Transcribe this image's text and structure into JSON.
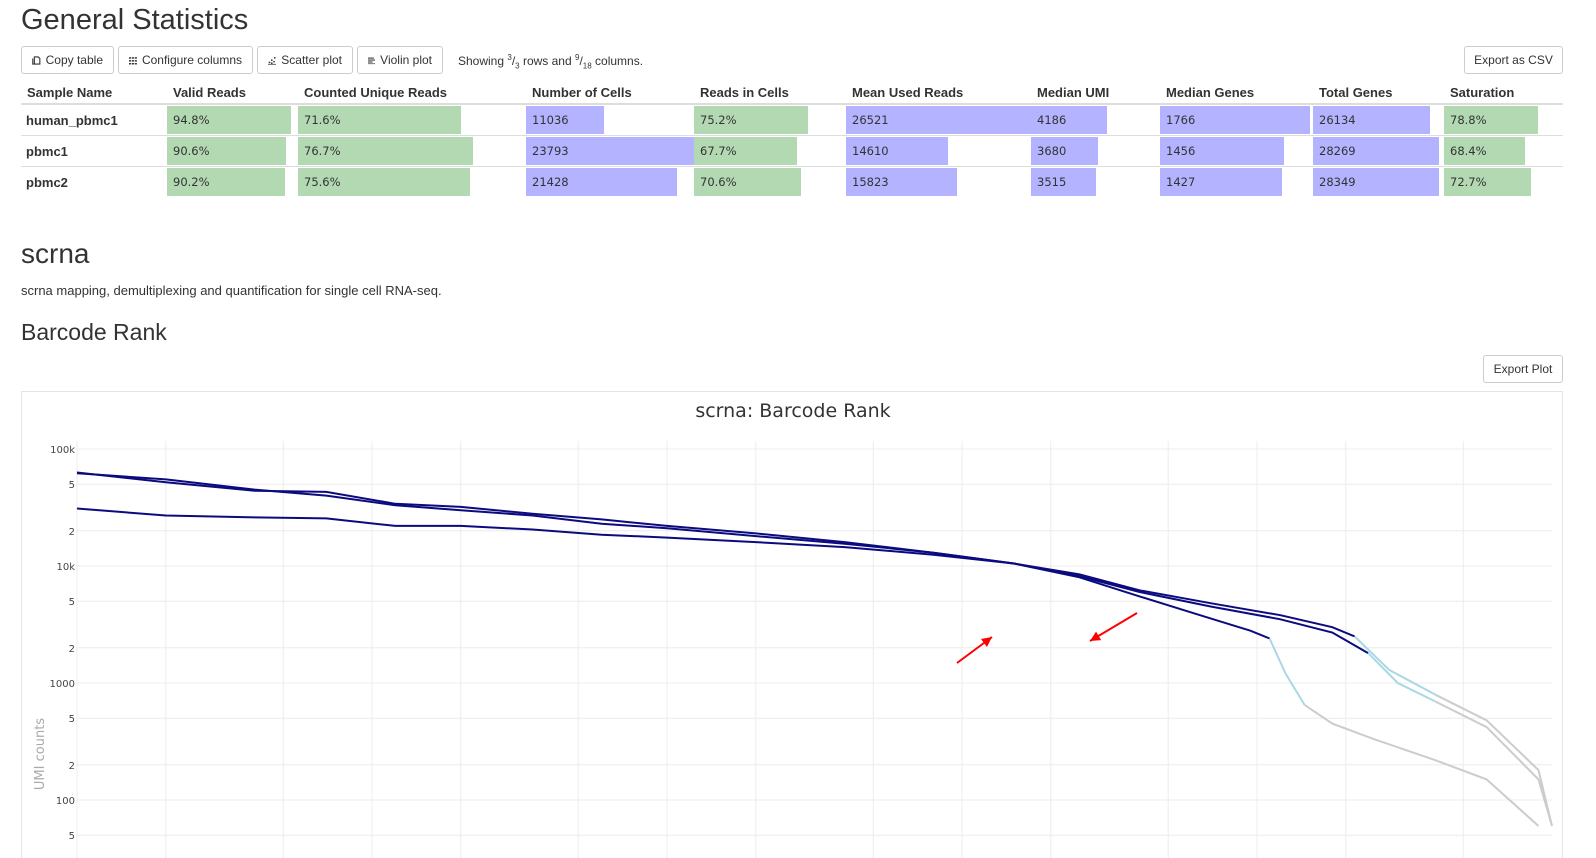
{
  "general_stats": {
    "title": "General Statistics",
    "buttons": {
      "copy": "Copy table",
      "configure": "Configure columns",
      "scatter": "Scatter plot",
      "violin": "Violin plot",
      "export_csv": "Export as CSV"
    },
    "showing": {
      "prefix": "Showing ",
      "rows_num": "3",
      "rows_den": "3",
      "mid": " rows and ",
      "cols_num": "9",
      "cols_den": "18",
      "suffix": " columns."
    },
    "columns": [
      "Sample Name",
      "Valid Reads",
      "Counted Unique Reads",
      "Number of Cells",
      "Reads in Cells",
      "Mean Used Reads",
      "Median UMI",
      "Median Genes",
      "Total Genes",
      "Saturation"
    ],
    "rows": [
      {
        "name": "human_pbmc1",
        "cells": [
          "94.8%",
          "71.6%",
          "11036",
          "75.2%",
          "26521",
          "4186",
          "1766",
          "26134",
          "78.8%"
        ],
        "fills": [
          0.948,
          0.716,
          0.464,
          0.752,
          0.998,
          0.59,
          0.98,
          0.89,
          0.788
        ]
      },
      {
        "name": "pbmc1",
        "cells": [
          "90.6%",
          "76.7%",
          "23793",
          "67.7%",
          "14610",
          "3680",
          "1456",
          "28269",
          "68.4%"
        ],
        "fills": [
          0.906,
          0.767,
          1.0,
          0.677,
          0.55,
          0.52,
          0.81,
          0.96,
          0.684
        ]
      },
      {
        "name": "pbmc2",
        "cells": [
          "90.2%",
          "75.6%",
          "21428",
          "70.6%",
          "15823",
          "3515",
          "1427",
          "28349",
          "72.7%"
        ],
        "fills": [
          0.902,
          0.756,
          0.9,
          0.706,
          0.6,
          0.5,
          0.8,
          0.965,
          0.727
        ]
      }
    ],
    "bar_colors": {
      "percent": "#b3d9b3",
      "count": "#b3b3ff"
    }
  },
  "section": {
    "title": "scrna",
    "description": "scrna mapping, demultiplexing and quantification for single cell RNA-seq."
  },
  "barcode_rank": {
    "heading": "Barcode Rank",
    "export_button": "Export Plot"
  },
  "chart_data": {
    "type": "line",
    "title": "scrna: Barcode Rank",
    "ylabel": "UMI counts",
    "xlabel": "",
    "yscale": "log",
    "ylim": [
      40,
      100000
    ],
    "xscale": "log",
    "xlim": [
      1,
      100000
    ],
    "y_ticks": [
      "100k",
      "5",
      "2",
      "10k",
      "5",
      "2",
      "1000",
      "5",
      "2",
      "100",
      "5"
    ],
    "grid": true,
    "colors": {
      "cells": "#0b0b7f",
      "background": "#a8d8e6",
      "empty": "#cccccc",
      "arrows": "#ff0000"
    },
    "series": [
      {
        "x": [
          1,
          2,
          4,
          7,
          12,
          20,
          35,
          60,
          100,
          200,
          400,
          800,
          1500,
          2500,
          4000,
          6000,
          8000,
          9500,
          11036
        ],
        "y": [
          62000,
          55000,
          45000,
          40000,
          33000,
          30000,
          27000,
          23000,
          21000,
          18000,
          15500,
          13000,
          10500,
          8000,
          5500,
          4000,
          3200,
          2800,
          2400
        ],
        "bg_x": [
          11036,
          12500,
          14500,
          18000,
          25000,
          40000,
          60000,
          90000
        ],
        "bg_y": [
          2400,
          1200,
          650,
          450,
          330,
          220,
          150,
          60
        ]
      },
      {
        "x": [
          1,
          2,
          4,
          7,
          12,
          20,
          35,
          60,
          100,
          200,
          400,
          800,
          1500,
          2500,
          4000,
          7000,
          12000,
          18000,
          23793
        ],
        "y": [
          63000,
          52000,
          44000,
          43000,
          34000,
          32000,
          28000,
          25000,
          22000,
          19000,
          16000,
          13000,
          10500,
          8200,
          6000,
          4500,
          3500,
          2700,
          1800
        ],
        "bg_x": [
          23793,
          30000,
          40000,
          60000,
          90000,
          100000
        ],
        "bg_y": [
          1800,
          1000,
          700,
          420,
          150,
          60
        ]
      },
      {
        "x": [
          1,
          2,
          4,
          7,
          12,
          20,
          35,
          60,
          100,
          200,
          400,
          800,
          1500,
          2500,
          4000,
          7000,
          12000,
          18000,
          21428
        ],
        "y": [
          31000,
          27000,
          26000,
          25500,
          22000,
          22000,
          20500,
          18500,
          17500,
          16000,
          14500,
          12500,
          10500,
          8500,
          6200,
          4800,
          3800,
          3000,
          2500
        ],
        "bg_x": [
          21428,
          28000,
          40000,
          60000,
          90000,
          100000
        ],
        "bg_y": [
          2500,
          1300,
          800,
          480,
          180,
          60
        ]
      }
    ]
  }
}
